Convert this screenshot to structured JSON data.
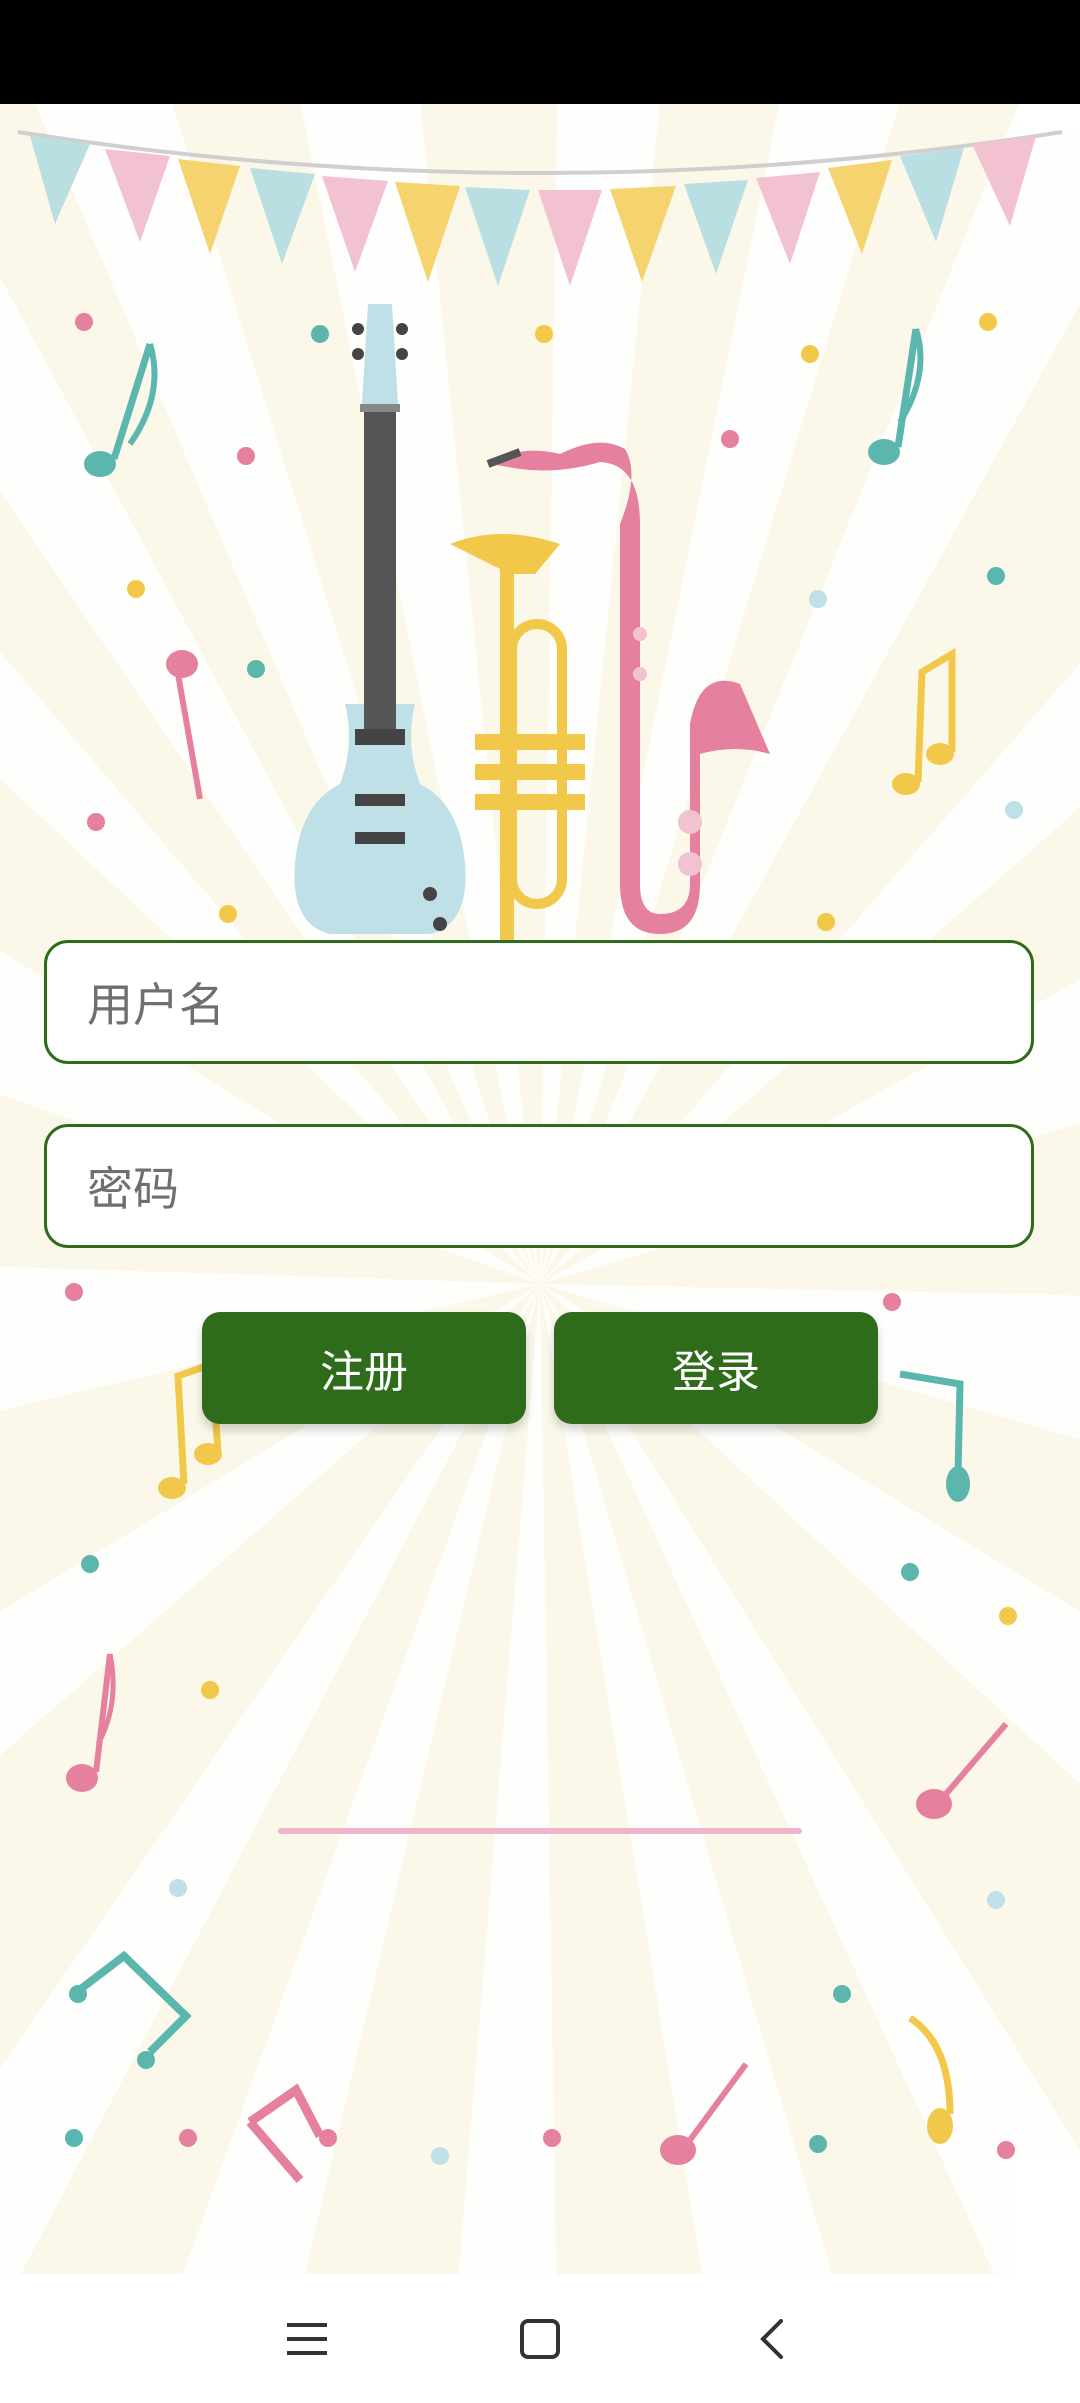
{
  "form": {
    "username_placeholder": "用户名",
    "password_placeholder": "密码"
  },
  "buttons": {
    "register_label": "注册",
    "login_label": "登录"
  },
  "colors": {
    "accent": "#2e6b1a",
    "background": "#fbf8ea",
    "pink": "#e6809f",
    "teal": "#5bb7ae",
    "yellow": "#f2c84b",
    "light_blue": "#bfe0e6"
  },
  "nav": {
    "icons": [
      "menu-icon",
      "home-icon",
      "back-icon"
    ]
  }
}
